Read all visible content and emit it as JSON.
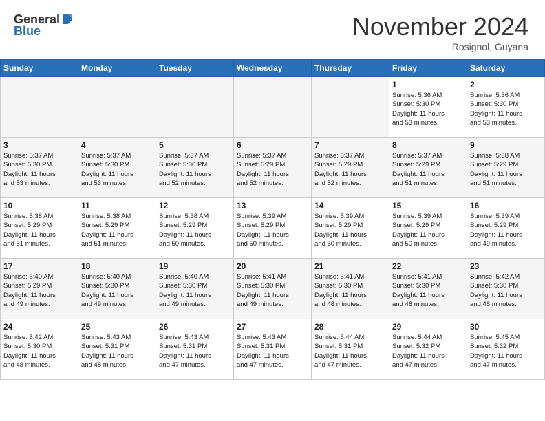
{
  "header": {
    "logo_general": "General",
    "logo_blue": "Blue",
    "month": "November 2024",
    "location": "Rosignol, Guyana"
  },
  "weekdays": [
    "Sunday",
    "Monday",
    "Tuesday",
    "Wednesday",
    "Thursday",
    "Friday",
    "Saturday"
  ],
  "weeks": [
    [
      {
        "day": "",
        "info": ""
      },
      {
        "day": "",
        "info": ""
      },
      {
        "day": "",
        "info": ""
      },
      {
        "day": "",
        "info": ""
      },
      {
        "day": "",
        "info": ""
      },
      {
        "day": "1",
        "info": "Sunrise: 5:36 AM\nSunset: 5:30 PM\nDaylight: 11 hours\nand 53 minutes."
      },
      {
        "day": "2",
        "info": "Sunrise: 5:36 AM\nSunset: 5:30 PM\nDaylight: 11 hours\nand 53 minutes."
      }
    ],
    [
      {
        "day": "3",
        "info": "Sunrise: 5:37 AM\nSunset: 5:30 PM\nDaylight: 11 hours\nand 53 minutes."
      },
      {
        "day": "4",
        "info": "Sunrise: 5:37 AM\nSunset: 5:30 PM\nDaylight: 11 hours\nand 53 minutes."
      },
      {
        "day": "5",
        "info": "Sunrise: 5:37 AM\nSunset: 5:30 PM\nDaylight: 11 hours\nand 52 minutes."
      },
      {
        "day": "6",
        "info": "Sunrise: 5:37 AM\nSunset: 5:29 PM\nDaylight: 11 hours\nand 52 minutes."
      },
      {
        "day": "7",
        "info": "Sunrise: 5:37 AM\nSunset: 5:29 PM\nDaylight: 11 hours\nand 52 minutes."
      },
      {
        "day": "8",
        "info": "Sunrise: 5:37 AM\nSunset: 5:29 PM\nDaylight: 11 hours\nand 51 minutes."
      },
      {
        "day": "9",
        "info": "Sunrise: 5:38 AM\nSunset: 5:29 PM\nDaylight: 11 hours\nand 51 minutes."
      }
    ],
    [
      {
        "day": "10",
        "info": "Sunrise: 5:38 AM\nSunset: 5:29 PM\nDaylight: 11 hours\nand 51 minutes."
      },
      {
        "day": "11",
        "info": "Sunrise: 5:38 AM\nSunset: 5:29 PM\nDaylight: 11 hours\nand 51 minutes."
      },
      {
        "day": "12",
        "info": "Sunrise: 5:38 AM\nSunset: 5:29 PM\nDaylight: 11 hours\nand 50 minutes."
      },
      {
        "day": "13",
        "info": "Sunrise: 5:39 AM\nSunset: 5:29 PM\nDaylight: 11 hours\nand 50 minutes."
      },
      {
        "day": "14",
        "info": "Sunrise: 5:39 AM\nSunset: 5:29 PM\nDaylight: 11 hours\nand 50 minutes."
      },
      {
        "day": "15",
        "info": "Sunrise: 5:39 AM\nSunset: 5:29 PM\nDaylight: 11 hours\nand 50 minutes."
      },
      {
        "day": "16",
        "info": "Sunrise: 5:39 AM\nSunset: 5:29 PM\nDaylight: 11 hours\nand 49 minutes."
      }
    ],
    [
      {
        "day": "17",
        "info": "Sunrise: 5:40 AM\nSunset: 5:29 PM\nDaylight: 11 hours\nand 49 minutes."
      },
      {
        "day": "18",
        "info": "Sunrise: 5:40 AM\nSunset: 5:30 PM\nDaylight: 11 hours\nand 49 minutes."
      },
      {
        "day": "19",
        "info": "Sunrise: 5:40 AM\nSunset: 5:30 PM\nDaylight: 11 hours\nand 49 minutes."
      },
      {
        "day": "20",
        "info": "Sunrise: 5:41 AM\nSunset: 5:30 PM\nDaylight: 11 hours\nand 49 minutes."
      },
      {
        "day": "21",
        "info": "Sunrise: 5:41 AM\nSunset: 5:30 PM\nDaylight: 11 hours\nand 48 minutes."
      },
      {
        "day": "22",
        "info": "Sunrise: 5:41 AM\nSunset: 5:30 PM\nDaylight: 11 hours\nand 48 minutes."
      },
      {
        "day": "23",
        "info": "Sunrise: 5:42 AM\nSunset: 5:30 PM\nDaylight: 11 hours\nand 48 minutes."
      }
    ],
    [
      {
        "day": "24",
        "info": "Sunrise: 5:42 AM\nSunset: 5:30 PM\nDaylight: 11 hours\nand 48 minutes."
      },
      {
        "day": "25",
        "info": "Sunrise: 5:43 AM\nSunset: 5:31 PM\nDaylight: 11 hours\nand 48 minutes."
      },
      {
        "day": "26",
        "info": "Sunrise: 5:43 AM\nSunset: 5:31 PM\nDaylight: 11 hours\nand 47 minutes."
      },
      {
        "day": "27",
        "info": "Sunrise: 5:43 AM\nSunset: 5:31 PM\nDaylight: 11 hours\nand 47 minutes."
      },
      {
        "day": "28",
        "info": "Sunrise: 5:44 AM\nSunset: 5:31 PM\nDaylight: 11 hours\nand 47 minutes."
      },
      {
        "day": "29",
        "info": "Sunrise: 5:44 AM\nSunset: 5:32 PM\nDaylight: 11 hours\nand 47 minutes."
      },
      {
        "day": "30",
        "info": "Sunrise: 5:45 AM\nSunset: 5:32 PM\nDaylight: 11 hours\nand 47 minutes."
      }
    ]
  ]
}
